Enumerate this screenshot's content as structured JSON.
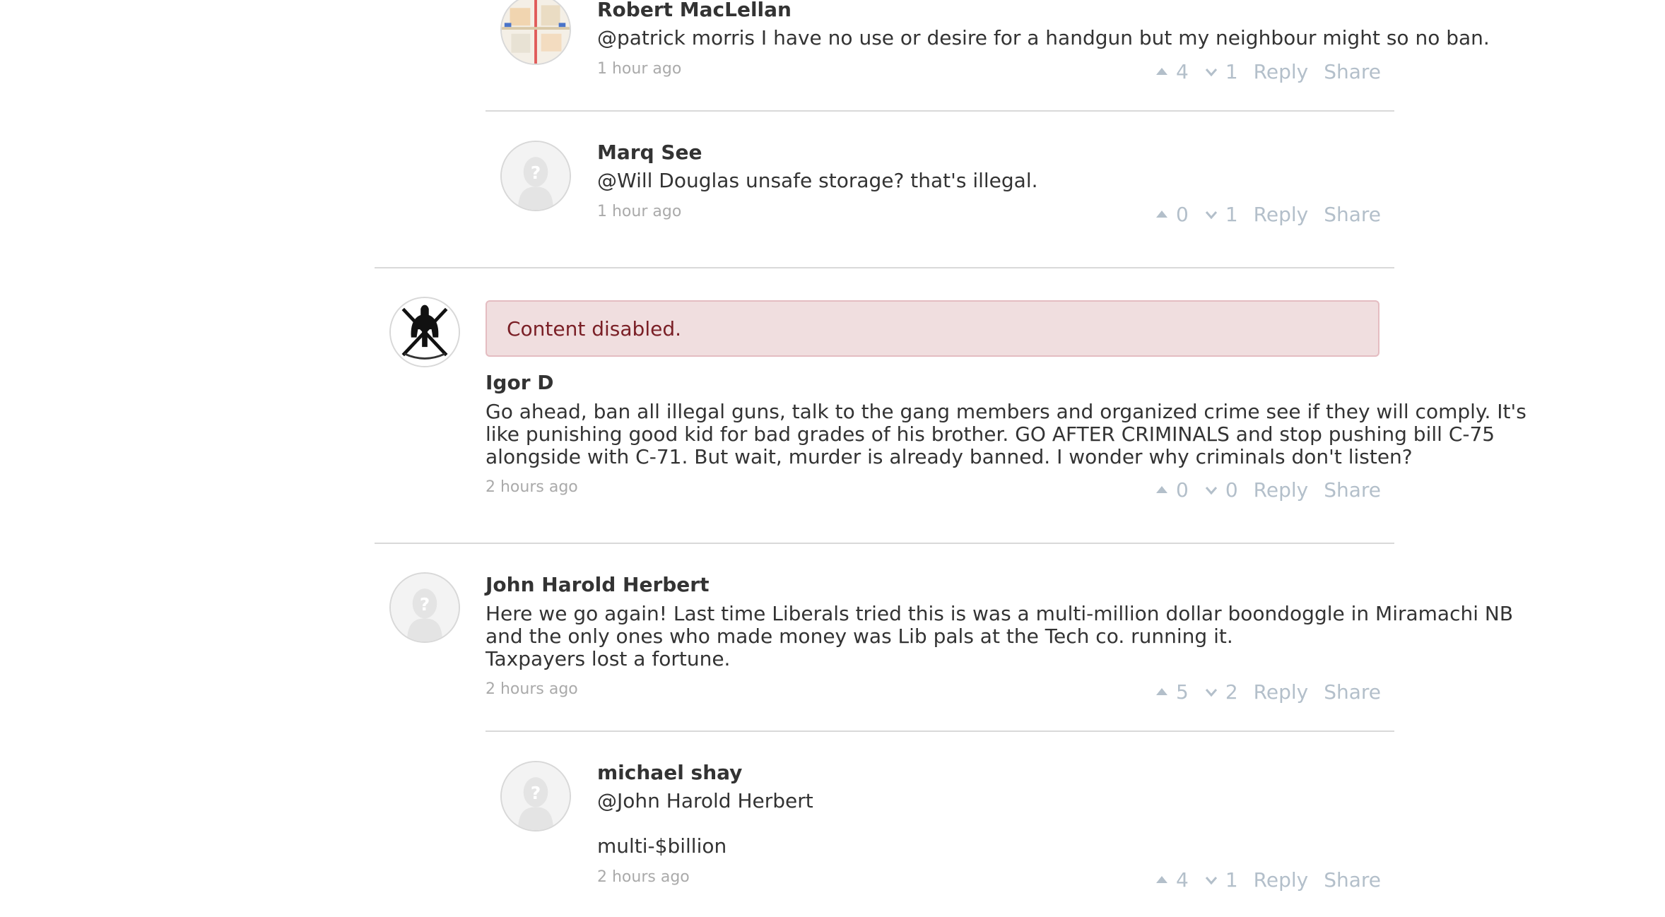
{
  "comments": [
    {
      "author": "Robert MacLellan",
      "avatar_icon": "map-avatar-icon",
      "body_lines": [
        "@patrick morris I have no use or desire for a handgun but my neighbour might so no ban."
      ],
      "time": "1 hour ago",
      "upvotes": "4",
      "downvotes": "1",
      "reply_label": "Reply",
      "share_label": "Share"
    },
    {
      "author": "Marq See",
      "avatar_icon": "default-avatar-icon",
      "body_lines": [
        "@Will Douglas unsafe storage? that's illegal."
      ],
      "time": "1 hour ago",
      "upvotes": "0",
      "downvotes": "1",
      "reply_label": "Reply",
      "share_label": "Share"
    },
    {
      "notice": "Content disabled.",
      "author": "Igor D",
      "avatar_icon": "spartan-helmet-avatar-icon",
      "body_lines": [
        "Go ahead, ban all illegal guns, talk to the gang members and organized crime see if they will comply. It's",
        "like punishing good kid for bad grades of his brother. GO AFTER CRIMINALS and stop pushing bill C-75",
        "alongside with C-71. But wait, murder is already banned. I wonder why criminals don't listen?"
      ],
      "time": "2 hours ago",
      "upvotes": "0",
      "downvotes": "0",
      "reply_label": "Reply",
      "share_label": "Share"
    },
    {
      "author": "John Harold Herbert",
      "avatar_icon": "default-avatar-icon",
      "body_lines": [
        "Here we go again! Last time Liberals tried this is was a multi-million dollar boondoggle in Miramachi NB",
        "and the only ones who made money was Lib pals at the Tech co. running it.",
        "Taxpayers lost a fortune."
      ],
      "time": "2 hours ago",
      "upvotes": "5",
      "downvotes": "2",
      "reply_label": "Reply",
      "share_label": "Share"
    },
    {
      "author": "michael shay",
      "avatar_icon": "default-avatar-icon",
      "body_lines": [
        "@John Harold Herbert",
        "",
        "multi-$billion"
      ],
      "time": "2 hours ago",
      "upvotes": "4",
      "downvotes": "1",
      "reply_label": "Reply",
      "share_label": "Share"
    }
  ],
  "colors": {
    "text": "#333333",
    "meta": "#aaaaaa",
    "action": "#b3bfca",
    "divider": "#d9d9d9",
    "notice_bg": "#f0dedf",
    "notice_text": "#7a1f26"
  }
}
